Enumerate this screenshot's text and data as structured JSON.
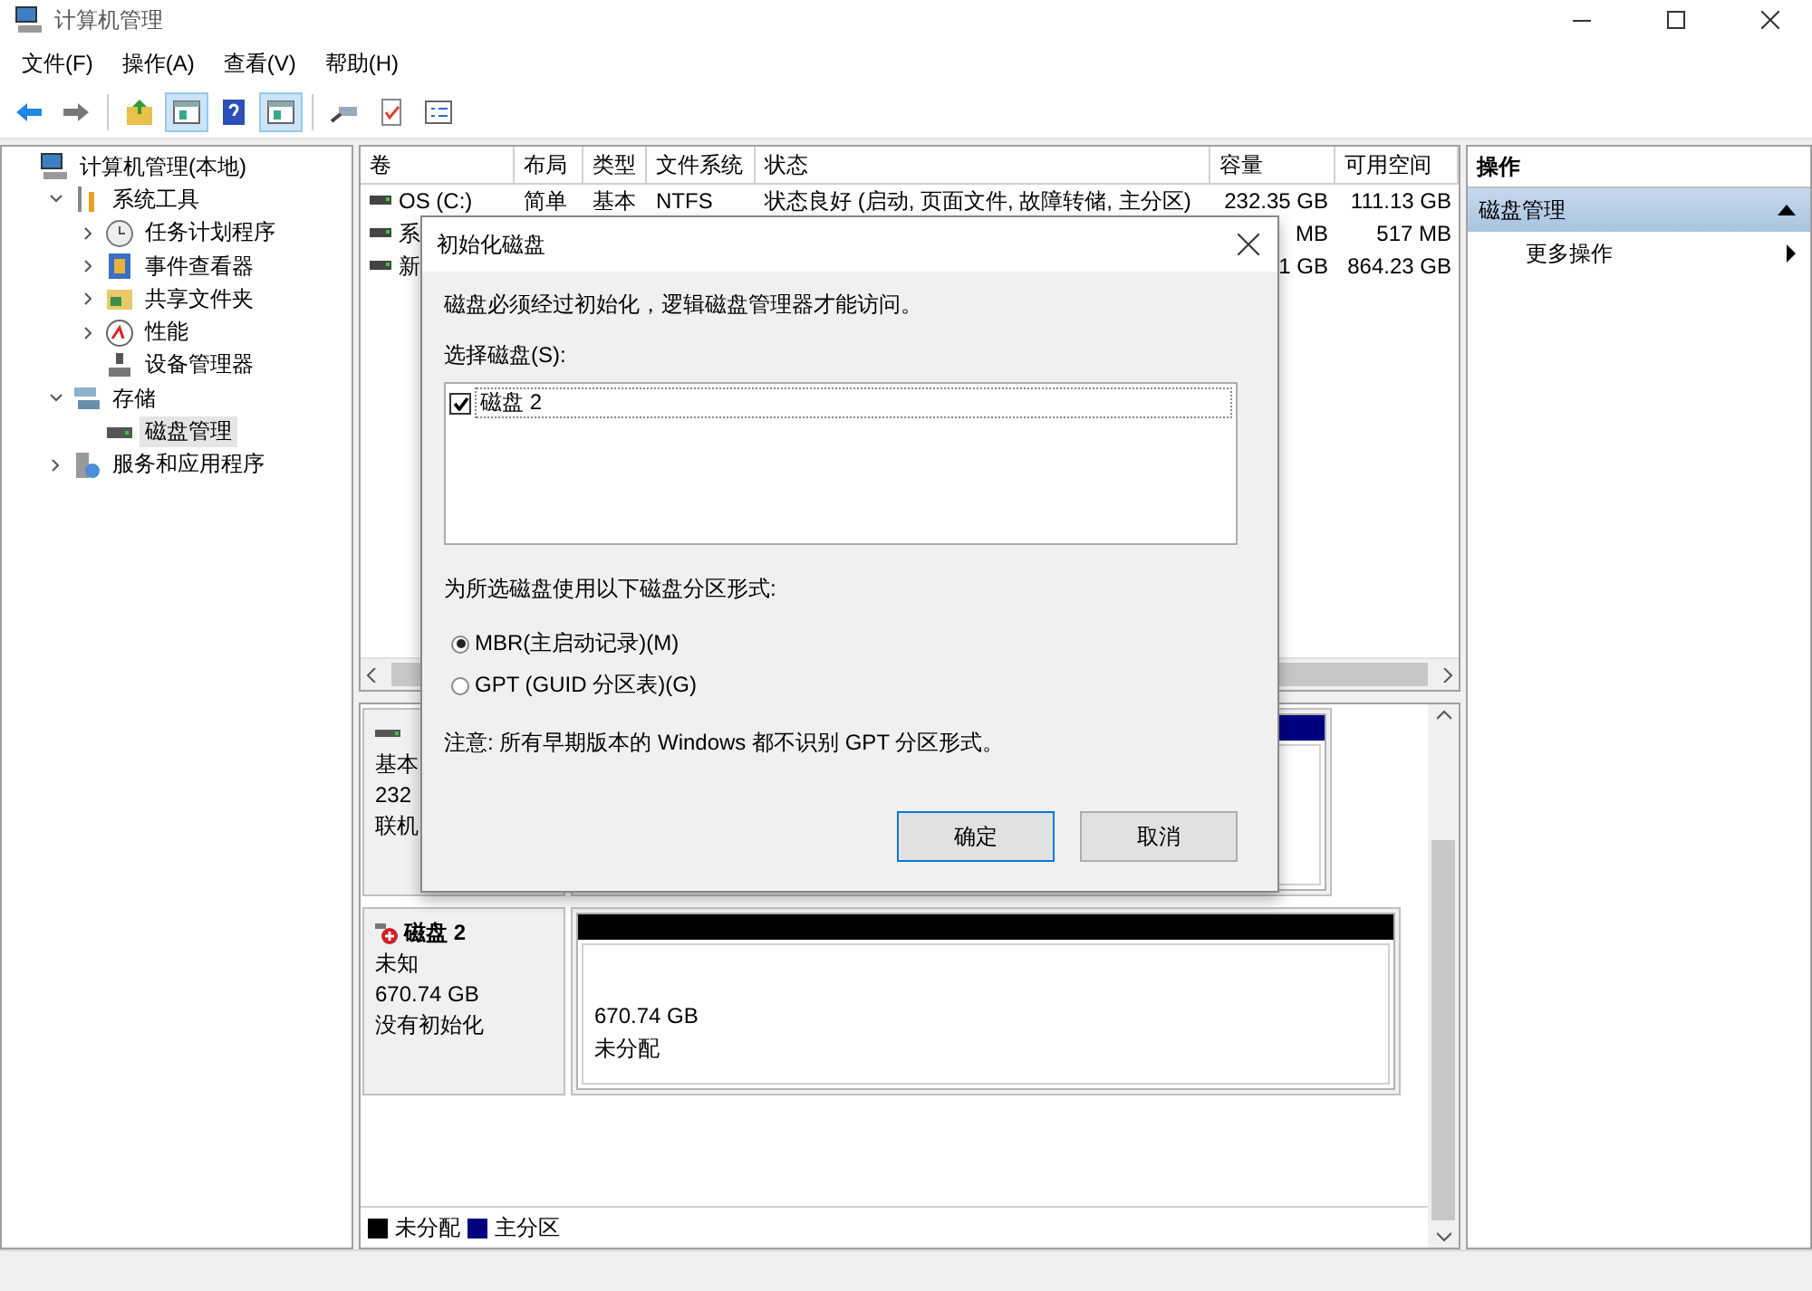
{
  "window": {
    "title": "计算机管理"
  },
  "menu": [
    {
      "label": "文件(F)"
    },
    {
      "label": "操作(A)"
    },
    {
      "label": "查看(V)"
    },
    {
      "label": "帮助(H)"
    }
  ],
  "toolbar": [
    {
      "kind": "back",
      "pressed": false
    },
    {
      "kind": "forward",
      "pressed": false
    },
    {
      "kind": "separator"
    },
    {
      "kind": "up",
      "pressed": false
    },
    {
      "kind": "pane",
      "pressed": true
    },
    {
      "kind": "help",
      "pressed": false
    },
    {
      "kind": "pane",
      "pressed": true
    },
    {
      "kind": "separator"
    },
    {
      "kind": "connect",
      "pressed": false
    },
    {
      "kind": "check",
      "pressed": false
    },
    {
      "kind": "properties",
      "pressed": false
    }
  ],
  "tree": [
    {
      "label": "计算机管理(本地)",
      "kind": "computer",
      "selected": false,
      "children": [
        {
          "label": "系统工具",
          "kind": "tools",
          "expanded": true,
          "selected": false,
          "children": [
            {
              "label": "任务计划程序",
              "kind": "clock",
              "expanded": false,
              "selected": false
            },
            {
              "label": "事件查看器",
              "kind": "log",
              "expanded": false,
              "selected": false
            },
            {
              "label": "共享文件夹",
              "kind": "share",
              "expanded": false,
              "selected": false
            },
            {
              "label": "性能",
              "kind": "perf",
              "expanded": false,
              "selected": false
            },
            {
              "label": "设备管理器",
              "kind": "device",
              "selected": false
            }
          ]
        },
        {
          "label": "存储",
          "kind": "storage",
          "expanded": true,
          "selected": false,
          "children": [
            {
              "label": "磁盘管理",
              "kind": "disk",
              "selected": true
            }
          ]
        },
        {
          "label": "服务和应用程序",
          "kind": "services",
          "expanded": false,
          "selected": false
        }
      ]
    }
  ],
  "table": {
    "columns": [
      "卷",
      "布局",
      "类型",
      "文件系统",
      "状态",
      "容量",
      "可用空间"
    ],
    "rows": [
      [
        "OS (C:)",
        "简单",
        "基本",
        "NTFS",
        "状态良好 (启动, 页面文件, 故障转储, 主分区)",
        "232.35 GB",
        "111.13 GB"
      ],
      [
        "系",
        "",
        "",
        "",
        "",
        "MB",
        "517 MB"
      ],
      [
        "新",
        "",
        "",
        "",
        "",
        "1 GB",
        "864.23 GB"
      ]
    ]
  },
  "disks": [
    {
      "initialized": true,
      "info": [
        "基本",
        "232",
        "联机"
      ],
      "partitions": [
        {
          "color": "#000080"
        }
      ]
    },
    {
      "name": "磁盘 2",
      "initialized": false,
      "info": [
        "未知",
        "670.74 GB",
        "没有初始化"
      ],
      "partitions": [
        {
          "color": "#000000",
          "size": "670.74 GB",
          "label": "未分配"
        }
      ]
    }
  ],
  "legend": [
    {
      "label": "未分配",
      "color": "#000000"
    },
    {
      "label": "主分区",
      "color": "#000080"
    }
  ],
  "actions": {
    "title": "操作",
    "sections": [
      {
        "label": "磁盘管理",
        "expanded": true,
        "items": [
          {
            "label": "更多操作"
          }
        ]
      }
    ]
  },
  "dialog": {
    "title": "初始化磁盘",
    "message": "磁盘必须经过初始化，逻辑磁盘管理器才能访问。",
    "select_label": "选择磁盘(S):",
    "disks": [
      {
        "label": "磁盘 2",
        "checked": true
      }
    ],
    "style_label": "为所选磁盘使用以下磁盘分区形式:",
    "options": [
      {
        "label": "MBR(主启动记录)(M)",
        "selected": true
      },
      {
        "label": "GPT (GUID 分区表)(G)",
        "selected": false
      }
    ],
    "note": "注意: 所有早期版本的 Windows 都不识别 GPT 分区形式。",
    "buttons": [
      {
        "label": "确定",
        "default": true
      },
      {
        "label": "取消",
        "default": false
      }
    ]
  }
}
